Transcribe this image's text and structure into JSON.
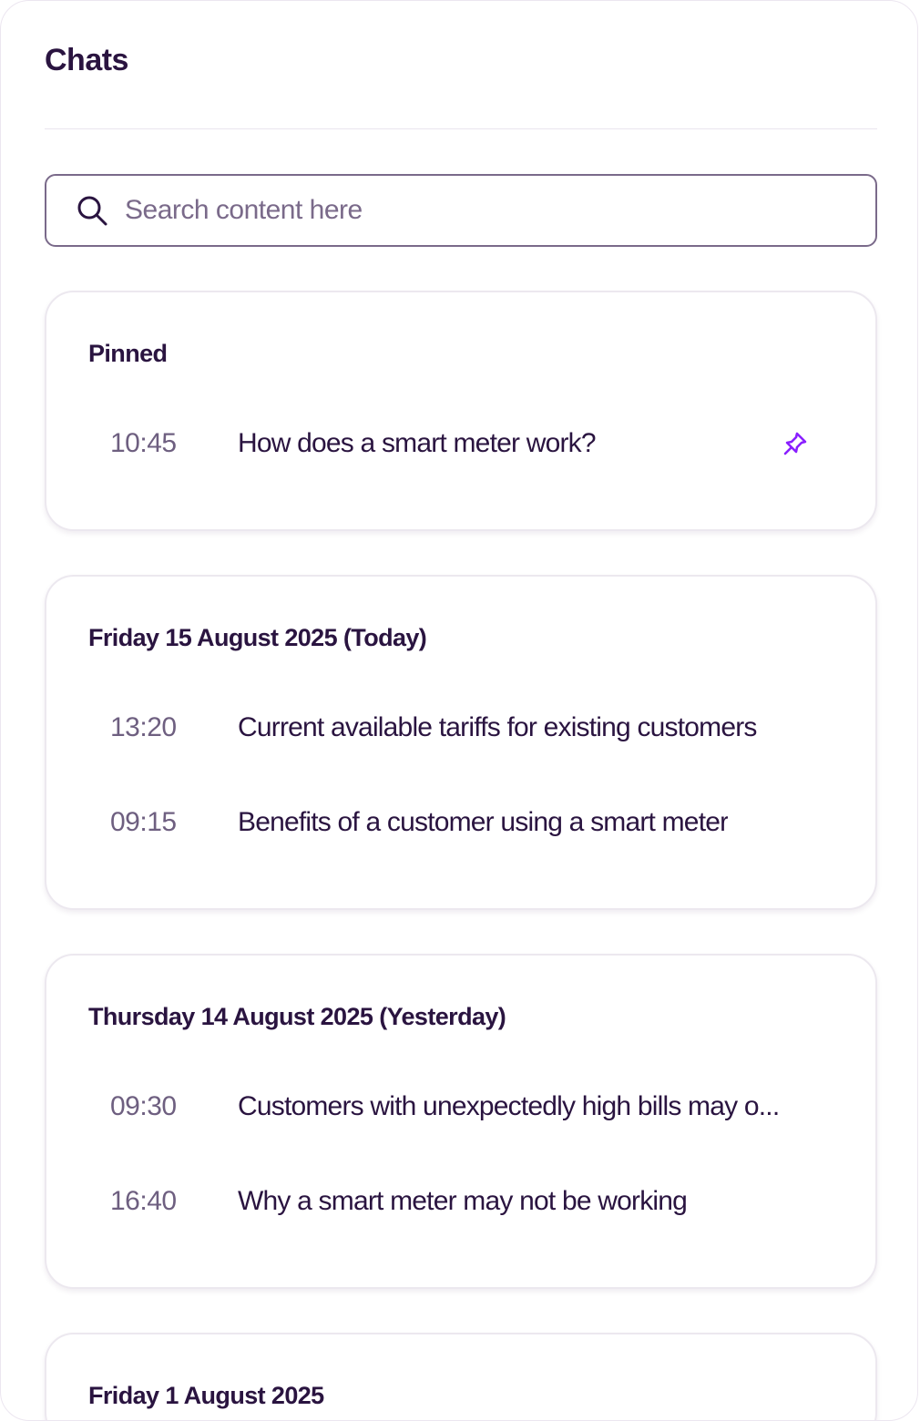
{
  "header": {
    "title": "Chats"
  },
  "search": {
    "placeholder": "Search content here",
    "icon": "search-icon"
  },
  "colors": {
    "text": "#2a1440",
    "muted": "#6e5f80",
    "pin": "#8a1fff"
  },
  "groups": [
    {
      "heading": "Pinned",
      "items": [
        {
          "time": "10:45",
          "title": "How does a smart meter work?",
          "pinned": true
        }
      ]
    },
    {
      "heading": "Friday 15 August 2025 (Today)",
      "items": [
        {
          "time": "13:20",
          "title": "Current available tariffs for existing customers"
        },
        {
          "time": "09:15",
          "title": "Benefits of a customer using a smart meter"
        }
      ]
    },
    {
      "heading": "Thursday 14 August 2025 (Yesterday)",
      "items": [
        {
          "time": "09:30",
          "title": "Customers with unexpectedly high bills may o..."
        },
        {
          "time": "16:40",
          "title": "Why a smart meter may not be working"
        }
      ]
    },
    {
      "heading": "Friday 1 August 2025",
      "items": []
    }
  ]
}
